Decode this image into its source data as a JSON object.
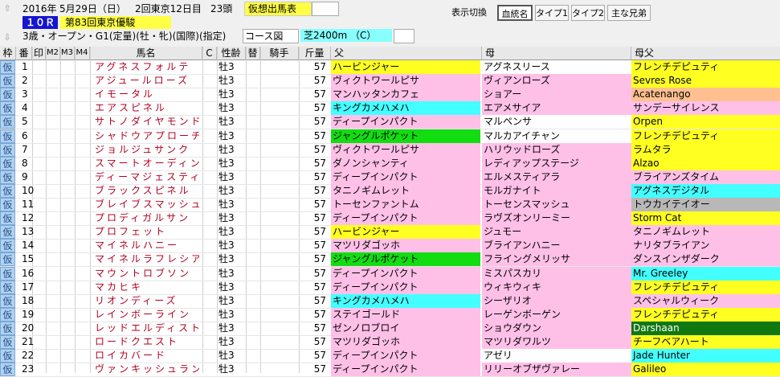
{
  "race": {
    "year": "2016年",
    "date": "5月29日（日）",
    "meeting": "2回東京12日目",
    "runners": "23頭",
    "status": "仮想出馬表",
    "race_no": "１０Ｒ",
    "race_name": "第83回東京優駿",
    "conditions": "3歳・オープン・G1(定量)(牡・牝)(国際)(指定)",
    "course_label": "コース図",
    "course": "芝2400m （C）"
  },
  "toolbar": {
    "display_toggle": "表示切換",
    "pedigree": "血統名",
    "type1": "タイプ1",
    "type2": "タイプ2",
    "siblings": "主な兄弟"
  },
  "headers": {
    "waku": "枠",
    "num": "番",
    "mark": "印",
    "m2": "M2",
    "m3": "M3",
    "m4": "M4",
    "name": "馬名",
    "c": "C",
    "sex_age": "性齢",
    "change": "替",
    "jockey": "騎手",
    "weight": "斤量",
    "sire": "父",
    "dam": "母",
    "bms": "母父"
  },
  "colors": {
    "pink": "#ffc0e8",
    "cyan": "#44ffff",
    "yellow": "#ffff22",
    "green": "#11dd11",
    "white": "#ffffff",
    "orange": "#ffc090",
    "gray": "#b8b8b8",
    "darkgreen": "#117711"
  },
  "horses": [
    {
      "kari": "仮",
      "num": "1",
      "name": "アグネスフォルテ",
      "sex": "牡3",
      "wt": "57",
      "sire": "ハービンジャー",
      "sire_c": "yellow",
      "dam": "アグネスリース",
      "dam_c": "white",
      "bms": "フレンチデピュティ",
      "bms_c": "yellow"
    },
    {
      "kari": "仮",
      "num": "2",
      "name": "アジュールローズ",
      "sex": "牡3",
      "wt": "57",
      "sire": "ヴィクトワールピサ",
      "sire_c": "pink",
      "dam": "ヴィアンローズ",
      "dam_c": "pink",
      "bms": "Sevres Rose",
      "bms_c": "yellow"
    },
    {
      "kari": "仮",
      "num": "3",
      "name": "イモータル",
      "sex": "牡3",
      "wt": "57",
      "sire": "マンハッタンカフェ",
      "sire_c": "pink",
      "dam": "ショアー",
      "dam_c": "pink",
      "bms": "Acatenango",
      "bms_c": "orange"
    },
    {
      "kari": "仮",
      "num": "4",
      "name": "エアスピネル",
      "sex": "牡3",
      "wt": "57",
      "sire": "キングカメハメハ",
      "sire_c": "cyan",
      "dam": "エアメサイア",
      "dam_c": "pink",
      "bms": "サンデーサイレンス",
      "bms_c": "pink"
    },
    {
      "kari": "仮",
      "num": "5",
      "name": "サトノダイヤモンド",
      "sex": "牡3",
      "wt": "57",
      "sire": "ディープインパクト",
      "sire_c": "pink",
      "dam": "マルペンサ",
      "dam_c": "white",
      "bms": "Orpen",
      "bms_c": "yellow"
    },
    {
      "kari": "仮",
      "num": "6",
      "name": "シャドウアプローチ",
      "sex": "牡3",
      "wt": "57",
      "sire": "ジャングルポケット",
      "sire_c": "green",
      "dam": "マルカアイチャン",
      "dam_c": "white",
      "bms": "フレンチデピュティ",
      "bms_c": "yellow"
    },
    {
      "kari": "仮",
      "num": "7",
      "name": "ジョルジュサンク",
      "sex": "牡3",
      "wt": "57",
      "sire": "ヴィクトワールピサ",
      "sire_c": "pink",
      "dam": "ハリウッドローズ",
      "dam_c": "pink",
      "bms": "ラムタラ",
      "bms_c": "yellow"
    },
    {
      "kari": "仮",
      "num": "8",
      "name": "スマートオーディン",
      "sex": "牡3",
      "wt": "57",
      "sire": "ダノンシャンティ",
      "sire_c": "pink",
      "dam": "レディアップステージ",
      "dam_c": "pink",
      "bms": "Alzao",
      "bms_c": "yellow"
    },
    {
      "kari": "仮",
      "num": "9",
      "name": "ディーマジェスティ",
      "sex": "牡3",
      "wt": "57",
      "sire": "ディープインパクト",
      "sire_c": "pink",
      "dam": "エルメスティアラ",
      "dam_c": "pink",
      "bms": "ブライアンズタイム",
      "bms_c": "pink"
    },
    {
      "kari": "仮",
      "num": "10",
      "name": "ブラックスピネル",
      "sex": "牡3",
      "wt": "57",
      "sire": "タニノギムレット",
      "sire_c": "pink",
      "dam": "モルガナイト",
      "dam_c": "pink",
      "bms": "アグネスデジタル",
      "bms_c": "cyan"
    },
    {
      "kari": "仮",
      "num": "11",
      "name": "ブレイブスマッシュ",
      "sex": "牡3",
      "wt": "57",
      "sire": "トーセンファントム",
      "sire_c": "pink",
      "dam": "トーセンスマッシュ",
      "dam_c": "pink",
      "bms": "トウカイテイオー",
      "bms_c": "gray"
    },
    {
      "kari": "仮",
      "num": "12",
      "name": "プロディガルサン",
      "sex": "牡3",
      "wt": "57",
      "sire": "ディープインパクト",
      "sire_c": "pink",
      "dam": "ラヴズオンリーミー",
      "dam_c": "pink",
      "bms": "Storm Cat",
      "bms_c": "yellow"
    },
    {
      "kari": "仮",
      "num": "13",
      "name": "プロフェット",
      "sex": "牡3",
      "wt": "57",
      "sire": "ハービンジャー",
      "sire_c": "yellow",
      "dam": "ジュモー",
      "dam_c": "pink",
      "bms": "タニノギムレット",
      "bms_c": "pink"
    },
    {
      "kari": "仮",
      "num": "14",
      "name": "マイネルハニー",
      "sex": "牡3",
      "wt": "57",
      "sire": "マツリダゴッホ",
      "sire_c": "pink",
      "dam": "ブライアンハニー",
      "dam_c": "pink",
      "bms": "ナリタブライアン",
      "bms_c": "pink"
    },
    {
      "kari": "仮",
      "num": "15",
      "name": "マイネルラフレシア",
      "sex": "牡3",
      "wt": "57",
      "sire": "ジャングルポケット",
      "sire_c": "green",
      "dam": "フライングメリッサ",
      "dam_c": "pink",
      "bms": "ダンスインザダーク",
      "bms_c": "pink"
    },
    {
      "kari": "仮",
      "num": "16",
      "name": "マウントロブソン",
      "sex": "牡3",
      "wt": "57",
      "sire": "ディープインパクト",
      "sire_c": "pink",
      "dam": "ミスパスカリ",
      "dam_c": "pink",
      "bms": "Mr. Greeley",
      "bms_c": "cyan"
    },
    {
      "kari": "仮",
      "num": "17",
      "name": "マカヒキ",
      "sex": "牡3",
      "wt": "57",
      "sire": "ディープインパクト",
      "sire_c": "pink",
      "dam": "ウィキウィキ",
      "dam_c": "pink",
      "bms": "フレンチデピュティ",
      "bms_c": "yellow"
    },
    {
      "kari": "仮",
      "num": "18",
      "name": "リオンディーズ",
      "sex": "牡3",
      "wt": "57",
      "sire": "キングカメハメハ",
      "sire_c": "cyan",
      "dam": "シーザリオ",
      "dam_c": "pink",
      "bms": "スペシャルウィーク",
      "bms_c": "pink"
    },
    {
      "kari": "仮",
      "num": "19",
      "name": "レインボーライン",
      "sex": "牡3",
      "wt": "57",
      "sire": "ステイゴールド",
      "sire_c": "pink",
      "dam": "レーゲンボーゲン",
      "dam_c": "pink",
      "bms": "フレンチデピュティ",
      "bms_c": "yellow"
    },
    {
      "kari": "仮",
      "num": "20",
      "name": "レッドエルディスト",
      "sex": "牡3",
      "wt": "57",
      "sire": "ゼンノロブロイ",
      "sire_c": "pink",
      "dam": "ショウダウン",
      "dam_c": "pink",
      "bms": "Darshaan",
      "bms_c": "darkgreen"
    },
    {
      "kari": "仮",
      "num": "21",
      "name": "ロードクエスト",
      "sex": "牡3",
      "wt": "57",
      "sire": "マツリダゴッホ",
      "sire_c": "pink",
      "dam": "マツリダワルツ",
      "dam_c": "pink",
      "bms": "チーフベアハート",
      "bms_c": "yellow"
    },
    {
      "kari": "仮",
      "num": "22",
      "name": "ロイカバード",
      "sex": "牡3",
      "wt": "57",
      "sire": "ディープインパクト",
      "sire_c": "pink",
      "dam": "アゼリ",
      "dam_c": "white",
      "bms": "Jade Hunter",
      "bms_c": "cyan"
    },
    {
      "kari": "仮",
      "num": "23",
      "name": "ヴァンキッシュラン",
      "sex": "牡3",
      "wt": "57",
      "sire": "ディープインパクト",
      "sire_c": "pink",
      "dam": "リリーオブザヴァレー",
      "dam_c": "pink",
      "bms": "Galileo",
      "bms_c": "yellow"
    }
  ]
}
